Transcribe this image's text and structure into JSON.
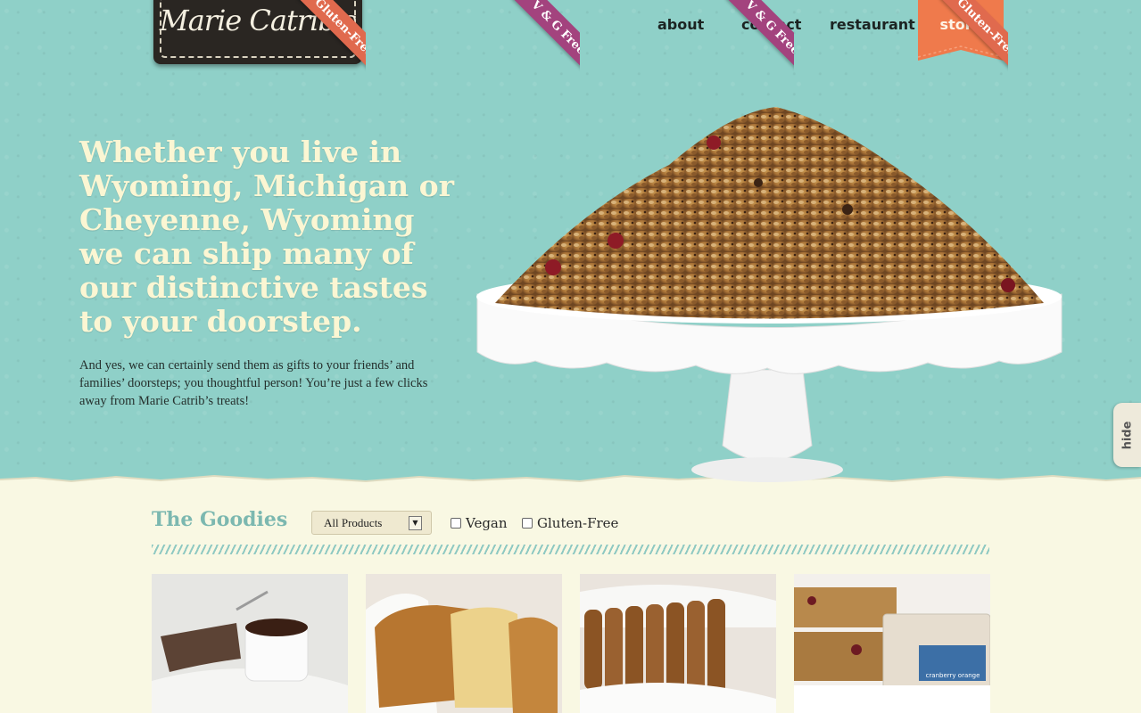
{
  "brand": {
    "logo_text": "Marie Catrib's"
  },
  "nav": {
    "items": [
      {
        "label": "about"
      },
      {
        "label": "contact"
      },
      {
        "label": "restaurant"
      },
      {
        "label": "store"
      }
    ],
    "active": "store"
  },
  "hero": {
    "headline": "Whether you live in Wyoming, Michigan or Cheyenne, Wyoming we can ship many of our distinctive tastes to your doorstep.",
    "subtext": "And yes, we can certainly send them as gifts to your friends’ and families’ doorsteps; you thoughtful person! You’re just a few clicks away from Marie Catrib’s treats!"
  },
  "side_tab": {
    "label": "hide"
  },
  "goodies": {
    "title": "The Goodies",
    "filter_select": {
      "selected": "All Products"
    },
    "filters": [
      {
        "label": "Vegan",
        "checked": false
      },
      {
        "label": "Gluten-Free",
        "checked": false
      }
    ],
    "products": [
      {
        "badge": "Gluten-Free",
        "badge_color": "#e06a4e",
        "image": "chocolate-sauce-ramekin"
      },
      {
        "badge": "V & G Free",
        "badge_color": "#a3437e",
        "image": "pound-cake-loaf"
      },
      {
        "badge": "V & G Free",
        "badge_color": "#a3437e",
        "image": "sliced-bread-loaf"
      },
      {
        "badge": "Gluten-Free",
        "badge_color": "#e06a4e",
        "image": "granola-bars-cranberry-orange"
      }
    ],
    "package_label": "cranberry orange"
  },
  "colors": {
    "hero_bg": "#8fd0c8",
    "cream": "#f9f8e3",
    "store_tab": "#ef7a4c",
    "title_teal": "#7cb8b0",
    "headline": "#fbf6d3"
  }
}
